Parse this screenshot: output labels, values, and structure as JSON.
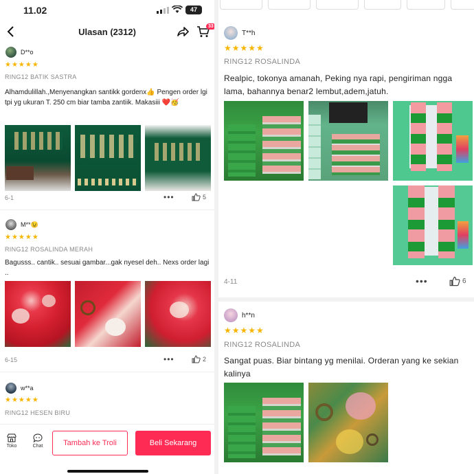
{
  "status_bar": {
    "time": "11.02",
    "battery": "47"
  },
  "header": {
    "title": "Ulasan (2312)",
    "cart_badge": "33"
  },
  "stars": "★★★★★",
  "left_reviews": [
    {
      "user": "D**o",
      "variant": "RING12 BATIK SASTRA",
      "text": "Alhamdulillah.,Menyenangkan santikk gordenx👍 Pengen order lgi tpi yg ukuran T. 250 cm biar tamba zantiik. Makasiii ❤️🥳",
      "date": "6-1",
      "likes": "5"
    },
    {
      "user": "M**😉",
      "variant": "RING12 ROSALINDA MERAH",
      "text": "Bagusss.. cantik.. sesuai gambar...gak nyesel deh.. Nexs order lagi ..",
      "date": "6-15",
      "likes": "2"
    },
    {
      "user": "w**a",
      "variant": "RING12 HESEN BIRU"
    }
  ],
  "right_reviews": [
    {
      "user": "T**h",
      "variant": "RING12 ROSALINDA",
      "text": "Realpic, tokonya amanah, Peking nya rapi, pengiriman ngga lama, bahannya benar2 lembut,adem,jatuh.",
      "date": "4-11",
      "likes": "6"
    },
    {
      "user": "h**n",
      "variant": "RING12 ROSALINDA",
      "text": "Sangat puas. Biar bintang yg menilai. Orderan yang ke sekian kalinya"
    }
  ],
  "bottom_bar": {
    "toko_label": "Toko",
    "chat_label": "Chat",
    "add_to_cart_label": "Tambah ke Troli",
    "buy_now_label": "Beli Sekarang"
  },
  "colors": {
    "accent": "#fe2c55",
    "star": "#f7b500"
  }
}
